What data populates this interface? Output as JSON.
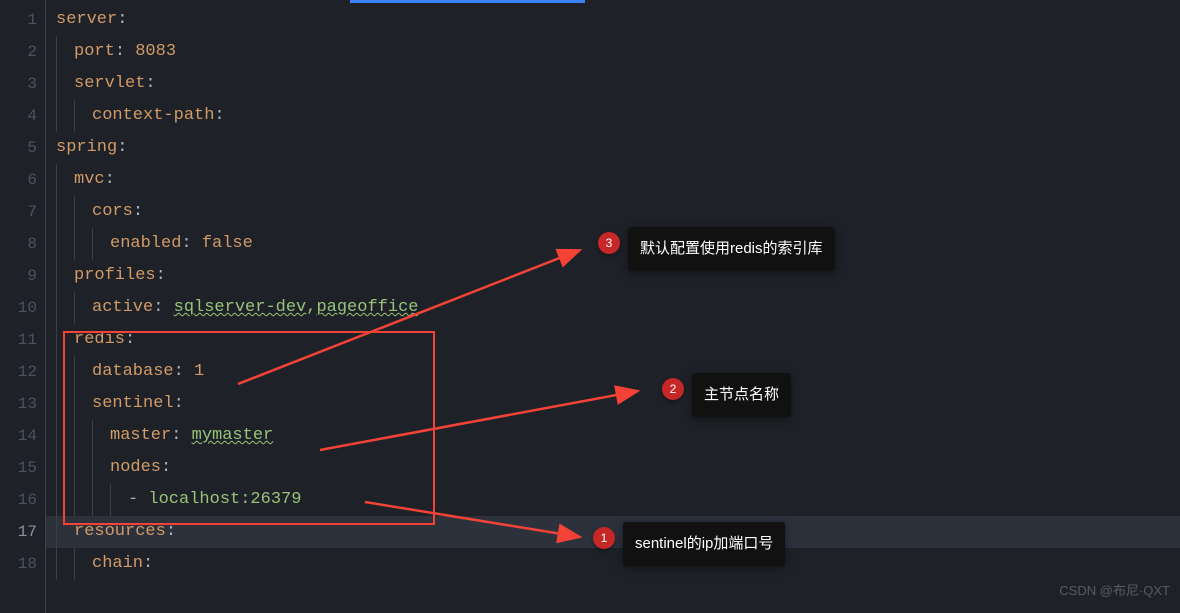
{
  "gutter_start": 1,
  "gutter_end": 18,
  "current_line": 17,
  "code": {
    "l1": {
      "key": "server"
    },
    "l2": {
      "key": "port",
      "val": "8083"
    },
    "l3": {
      "key": "servlet"
    },
    "l4": {
      "key": "context-path"
    },
    "l5": {
      "key": "spring"
    },
    "l6": {
      "key": "mvc"
    },
    "l7": {
      "key": "cors"
    },
    "l8": {
      "key": "enabled",
      "val": "false"
    },
    "l9": {
      "key": "profiles"
    },
    "l10": {
      "key": "active",
      "val_a": "sqlserver-dev",
      "val_b": "pageoffice"
    },
    "l11": {
      "key": "redis"
    },
    "l12": {
      "key": "database",
      "val": "1"
    },
    "l13": {
      "key": "sentinel"
    },
    "l14": {
      "key": "master",
      "val": "mymaster"
    },
    "l15": {
      "key": "nodes"
    },
    "l16": {
      "val": "localhost:26379"
    },
    "l17": {
      "key": "resources"
    },
    "l18": {
      "key": "chain"
    }
  },
  "annotations": {
    "a1": {
      "num": "1",
      "text": "sentinel的ip加端口号"
    },
    "a2": {
      "num": "2",
      "text": "主节点名称"
    },
    "a3": {
      "num": "3",
      "text": "默认配置使用redis的索引库"
    }
  },
  "watermark": "CSDN @布尼·QXT"
}
